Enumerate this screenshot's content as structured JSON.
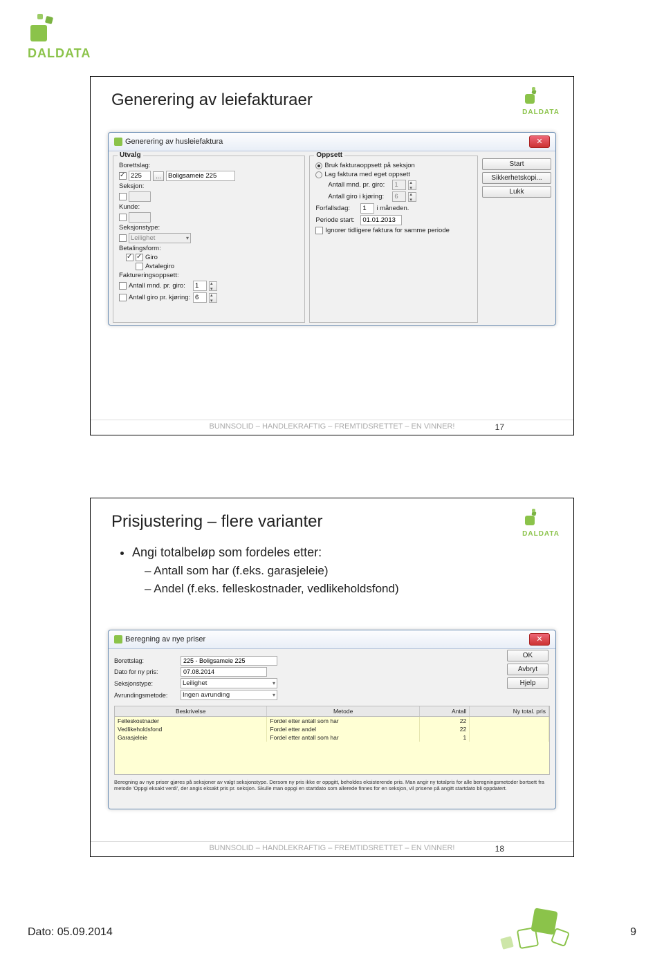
{
  "page": {
    "date_label": "Dato: 05.09.2014",
    "page_number": "9",
    "brand": "DALDATA"
  },
  "footer_line": "BUNNSOLID  –  HANDLEKRAFTIG  –  FREMTIDSRETTET  –  EN VINNER!",
  "slide1": {
    "title": "Generering av leiefakturaer",
    "page_num": "17",
    "dialog": {
      "title": "Generering av husleiefaktura",
      "utvalg": {
        "legend": "Utvalg",
        "borettslag_label": "Borettslag:",
        "borettslag_id": "225",
        "borettslag_name": "Boligsameie 225",
        "seksjon_label": "Seksjon:",
        "kunde_label": "Kunde:",
        "seksjonstype_label": "Seksjonstype:",
        "seksjonstype_value": "Leilighet",
        "betalingsform_label": "Betalingsform:",
        "giro": "Giro",
        "avtalegiro": "Avtalegiro",
        "fakt_oppsett_label": "Faktureringsoppsett:",
        "antall_mnd_label": "Antall mnd. pr. giro:",
        "antall_mnd_val": "1",
        "antall_giro_label": "Antall giro pr. kjøring:",
        "antall_giro_val": "6"
      },
      "oppsett": {
        "legend": "Oppsett",
        "opt1": "Bruk fakturaoppsett på seksjon",
        "opt2": "Lag faktura med eget oppsett",
        "antall_mnd_label": "Antall mnd. pr. giro:",
        "antall_mnd_val": "1",
        "antall_giro_label": "Antall giro i kjøring:",
        "antall_giro_val": "6",
        "forfallsdag_label": "Forfallsdag:",
        "forfallsdag_val": "1",
        "forfallsdag_suffix": "i måneden.",
        "periode_label": "Periode start:",
        "periode_val": "01.01.2013",
        "ignorer": "Ignorer tidligere faktura for samme periode"
      },
      "buttons": {
        "start": "Start",
        "sikkerhet": "Sikkerhetskopi...",
        "lukk": "Lukk"
      }
    }
  },
  "slide2": {
    "title": "Prisjustering – flere varianter",
    "page_num": "18",
    "bullets": {
      "b1": "Angi totalbeløp som fordeles etter:",
      "b1a": "Antall som har (f.eks. garasjeleie)",
      "b1b": "Andel (f.eks. felleskostnader, vedlikeholdsfond)"
    },
    "dialog": {
      "title": "Beregning av nye priser",
      "borettslag_label": "Borettslag:",
      "borettslag_val": "225 - Boligsameie 225",
      "dato_label": "Dato for ny pris:",
      "dato_val": "07.08.2014",
      "seksjonstype_label": "Seksjonstype:",
      "seksjonstype_val": "Leilighet",
      "avrunding_label": "Avrundingsmetode:",
      "avrunding_val": "Ingen avrunding",
      "buttons": {
        "ok": "OK",
        "avbryt": "Avbryt",
        "hjelp": "Hjelp"
      },
      "grid": {
        "h1": "Beskrivelse",
        "h2": "Metode",
        "h3": "Antall",
        "h4": "Ny total. pris",
        "rows": [
          {
            "c1": "Felleskostnader",
            "c2": "Fordel etter antall som har",
            "c3": "22",
            "c4": ""
          },
          {
            "c1": "Vedlikeholdsfond",
            "c2": "Fordel etter andel",
            "c3": "22",
            "c4": ""
          },
          {
            "c1": "Garasjeleie",
            "c2": "Fordel etter antall som har",
            "c3": "1",
            "c4": ""
          }
        ]
      },
      "note": "Beregning av nye priser gjøres på seksjoner av valgt seksjonstype. Dersom ny pris ikke er oppgitt, beholdes eksisterende pris. Man angir ny totalpris for alle beregningsmetoder bortsett fra metode 'Oppgi eksakt verdi', der angis eksakt pris pr. seksjon. Skulle man oppgi en startdato som allerede finnes for en seksjon, vil prisene på angitt startdato bli oppdatert."
    }
  }
}
